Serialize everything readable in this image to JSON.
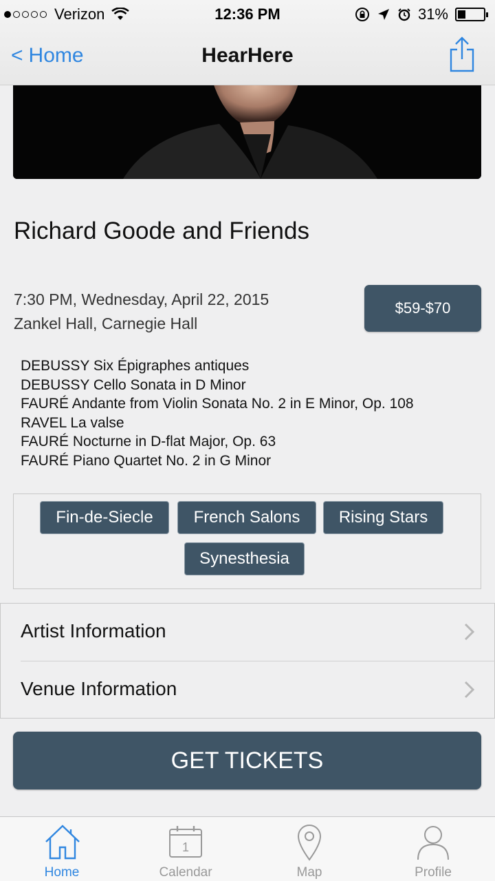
{
  "status_bar": {
    "carrier": "Verizon",
    "time": "12:36 PM",
    "battery": "31%",
    "battery_level": 0.31,
    "signal_bars": 1
  },
  "nav": {
    "back_label": "Home",
    "title": "HearHere"
  },
  "event": {
    "title": "Richard Goode and Friends",
    "datetime": "7:30 PM, Wednesday, April 22, 2015",
    "venue": "Zankel Hall, Carnegie Hall",
    "price": "$59-$70"
  },
  "program": [
    "DEBUSSY Six Épigraphes antiques",
    "DEBUSSY Cello Sonata in D Minor",
    "FAURÉ Andante from Violin Sonata No. 2 in E Minor, Op. 108",
    "RAVEL La valse",
    "FAURÉ Nocturne in D-flat Major, Op. 63",
    "FAURÉ Piano Quartet No. 2 in G Minor"
  ],
  "tags": [
    "Fin-de-Siecle",
    "French Salons",
    "Rising Stars",
    "Synesthesia"
  ],
  "info_rows": [
    "Artist Information",
    "Venue Information"
  ],
  "cta": {
    "label": "GET TICKETS"
  },
  "tabs": [
    {
      "label": "Home",
      "icon": "home-icon",
      "active": true
    },
    {
      "label": "Calendar",
      "icon": "calendar-icon",
      "day": "1"
    },
    {
      "label": "Map",
      "icon": "map-pin-icon"
    },
    {
      "label": "Profile",
      "icon": "profile-icon"
    }
  ],
  "colors": {
    "accent": "#2f86e0",
    "button": "#3f5566",
    "background": "#efeff0"
  }
}
